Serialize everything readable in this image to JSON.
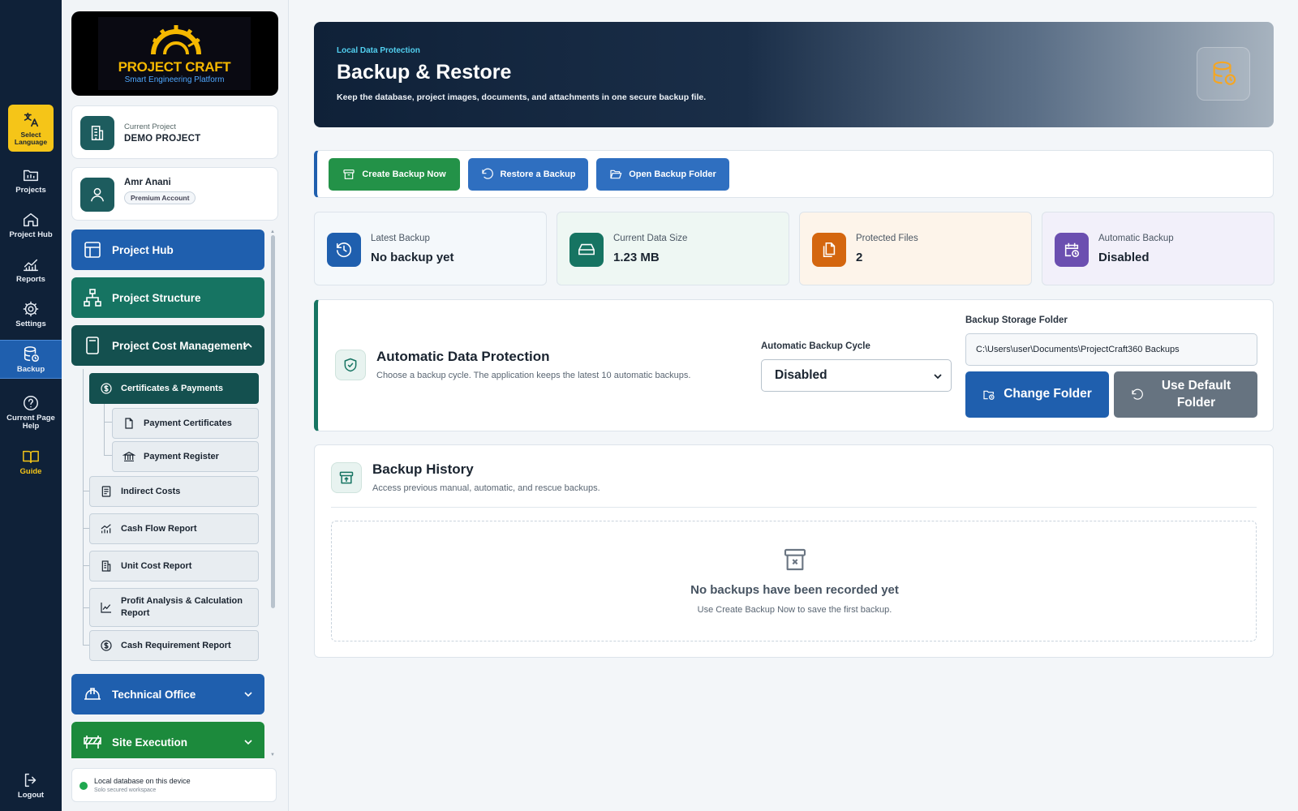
{
  "rail": {
    "items": [
      {
        "label": "Select Language",
        "icon": "translate-icon"
      },
      {
        "label": "Projects",
        "icon": "folder-icon"
      },
      {
        "label": "Project Hub",
        "icon": "home-icon"
      },
      {
        "label": "Reports",
        "icon": "chart-line-icon"
      },
      {
        "label": "Settings",
        "icon": "gear-icon"
      },
      {
        "label": "Backup",
        "icon": "database-icon"
      },
      {
        "label": "Current Page Help",
        "icon": "help-circle-icon"
      },
      {
        "label": "Guide",
        "icon": "book-icon"
      },
      {
        "label": "Logout",
        "icon": "logout-icon"
      }
    ]
  },
  "brand": {
    "title": "PROJECT CRAFT",
    "subtitle": "Smart Engineering Platform"
  },
  "project": {
    "label": "Current Project",
    "name": "DEMO PROJECT"
  },
  "user": {
    "name": "Amr Anani",
    "badge": "Premium Account"
  },
  "nav": {
    "project_hub": "Project Hub",
    "project_structure": "Project Structure",
    "cost_management": "Project Cost Management",
    "certificates_payments": "Certificates & Payments",
    "payment_certificates": "Payment Certificates",
    "payment_register": "Payment Register",
    "indirect_costs": "Indirect Costs",
    "cash_flow_report": "Cash Flow Report",
    "unit_cost_report": "Unit Cost Report",
    "profit_analysis": "Profit Analysis & Calculation Report",
    "cash_requirement": "Cash Requirement Report",
    "technical_office": "Technical Office",
    "site_execution": "Site Execution"
  },
  "status": {
    "main": "Local database on this device",
    "sub": "Solo secured workspace"
  },
  "hero": {
    "eyebrow": "Local Data Protection",
    "title": "Backup & Restore",
    "description": "Keep the database, project images, documents, and attachments in one secure backup file."
  },
  "actions": {
    "create": "Create Backup Now",
    "restore": "Restore a Backup",
    "open_folder": "Open Backup Folder"
  },
  "stats": [
    {
      "label": "Latest Backup",
      "value": "No backup yet",
      "color": "#1f5fae",
      "bg": "#f4f8fb"
    },
    {
      "label": "Current Data Size",
      "value": "1.23 MB",
      "color": "#167462",
      "bg": "#eef7f3"
    },
    {
      "label": "Protected Files",
      "value": "2",
      "color": "#d4660f",
      "bg": "#fdf4ea"
    },
    {
      "label": "Automatic Backup",
      "value": "Disabled",
      "color": "#6b4fb0",
      "bg": "#f2f0fa"
    }
  ],
  "protection": {
    "title": "Automatic Data Protection",
    "description": "Choose a backup cycle. The application keeps the latest 10 automatic backups.",
    "cycle_label": "Automatic Backup Cycle",
    "cycle_value": "Disabled",
    "folder_label": "Backup Storage Folder",
    "folder_value": "C:\\Users\\user\\Documents\\ProjectCraft360 Backups",
    "change_folder": "Change Folder",
    "use_default": "Use Default Folder"
  },
  "history": {
    "title": "Backup History",
    "description": "Access previous manual, automatic, and rescue backups.",
    "empty_title": "No backups have been recorded yet",
    "empty_sub": "Use Create Backup Now to save the first backup."
  }
}
